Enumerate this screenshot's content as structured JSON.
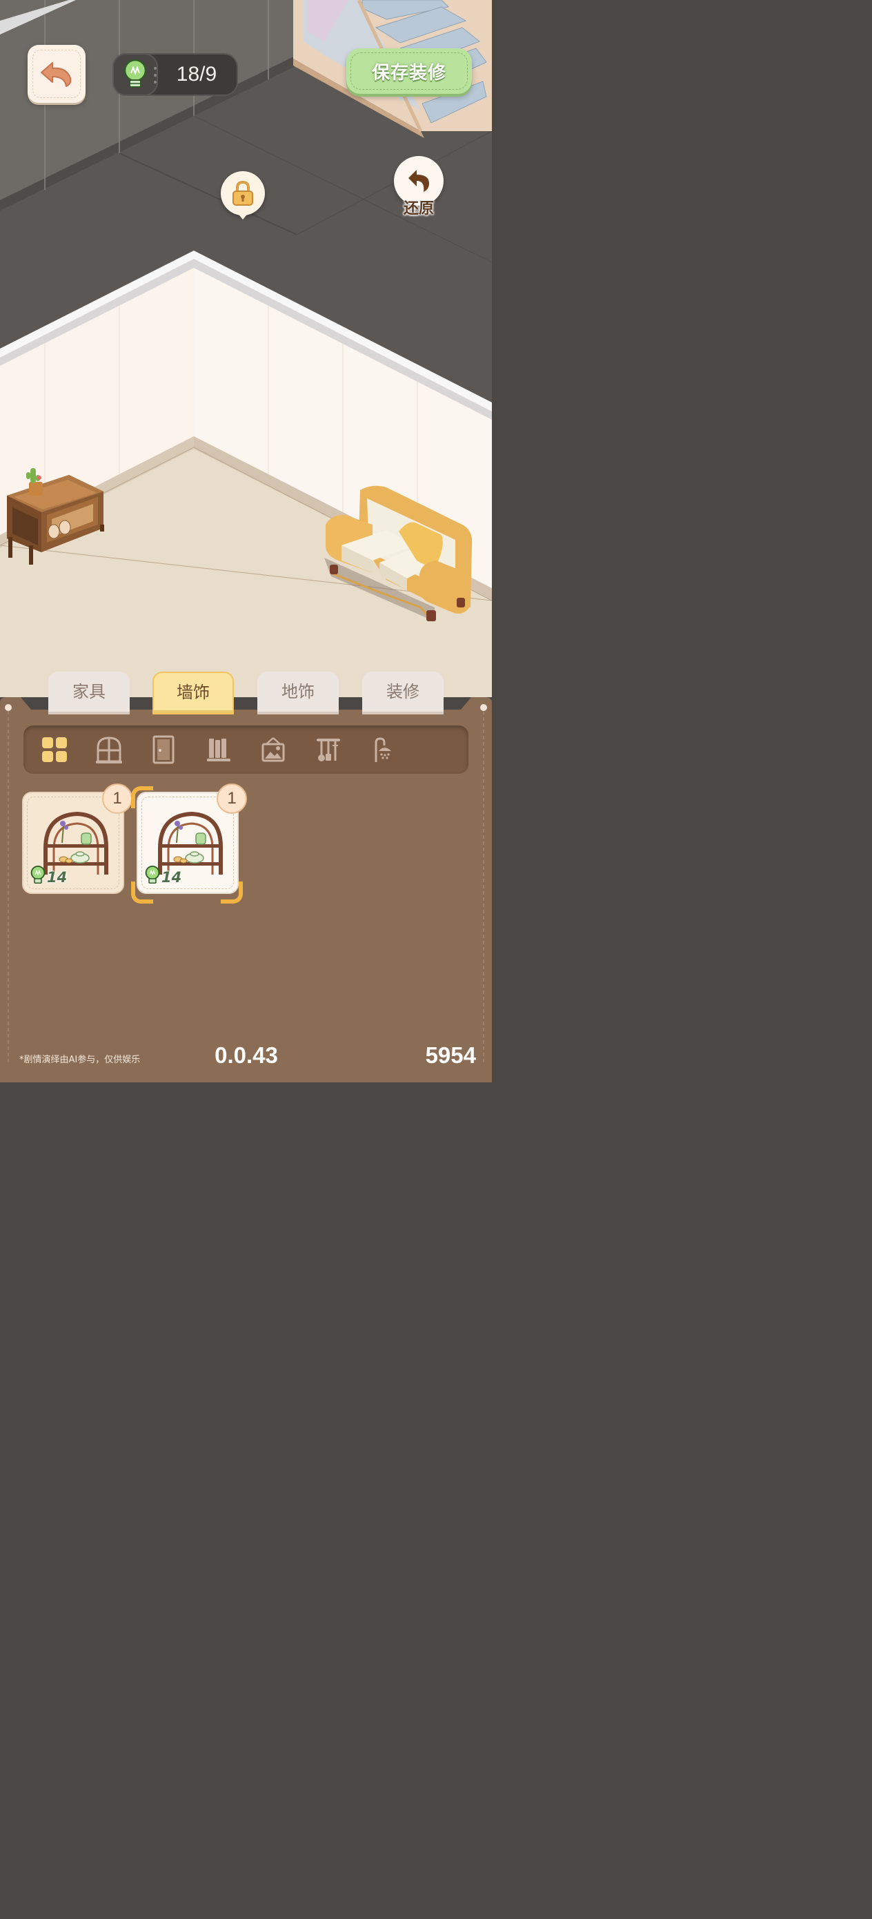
{
  "hud": {
    "energy_count": "18/9",
    "save_label": "保存装修",
    "restore_label": "还原"
  },
  "tabs": [
    {
      "label": "家具",
      "active": false
    },
    {
      "label": "墙饰",
      "active": true
    },
    {
      "label": "地饰",
      "active": false
    },
    {
      "label": "装修",
      "active": false
    }
  ],
  "categories": [
    {
      "icon": "grid-all-icon",
      "selected": true
    },
    {
      "icon": "window-icon",
      "selected": false
    },
    {
      "icon": "door-icon",
      "selected": false
    },
    {
      "icon": "bookshelf-icon",
      "selected": false
    },
    {
      "icon": "picture-frame-icon",
      "selected": false
    },
    {
      "icon": "kitchen-utensils-icon",
      "selected": false
    },
    {
      "icon": "shower-icon",
      "selected": false
    }
  ],
  "items": [
    {
      "name": "arched-wall-shelf",
      "quantity": "1",
      "cost": "14",
      "selected": false
    },
    {
      "name": "arched-wall-shelf",
      "quantity": "1",
      "cost": "14",
      "selected": true
    }
  ],
  "footer": {
    "note": "*剧情演绎由AI参与，仅供娱乐",
    "version": "0.0.43",
    "count": "5954"
  },
  "colors": {
    "panel_brown": "#8b6c55",
    "tab_active": "#fbe4a0",
    "save_green": "#b9e29c",
    "floor_dark": "#5e5a56",
    "wall_cream": "#fbf3ec"
  }
}
